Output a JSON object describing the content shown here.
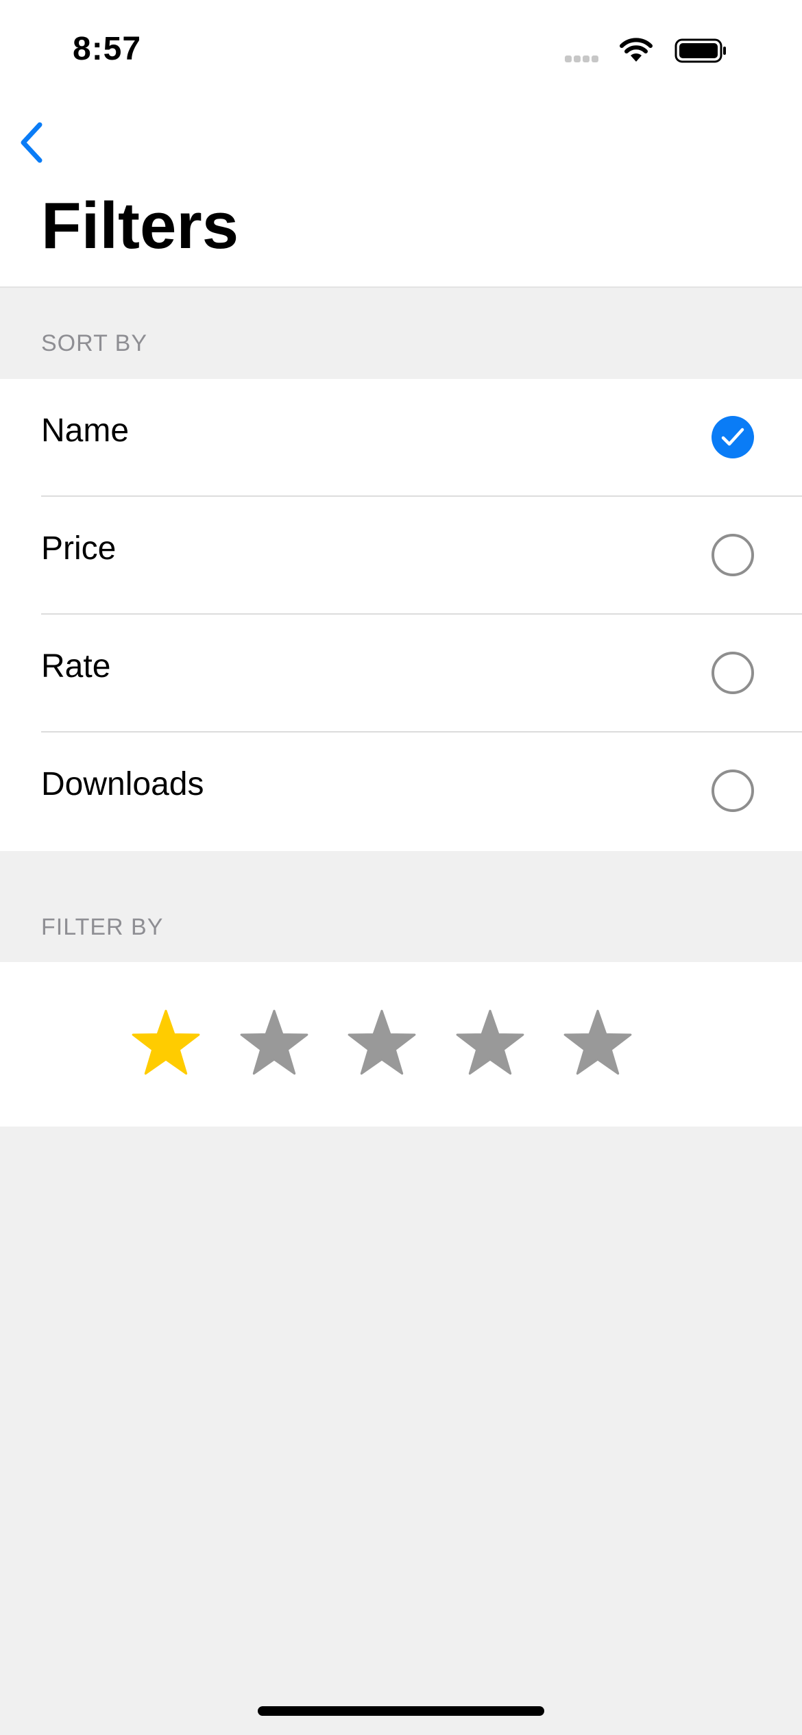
{
  "status_bar": {
    "time": "8:57"
  },
  "nav": {
    "title": "Filters"
  },
  "sort_section": {
    "header": "SORT BY",
    "options": [
      {
        "label": "Name",
        "selected": true
      },
      {
        "label": "Price",
        "selected": false
      },
      {
        "label": "Rate",
        "selected": false
      },
      {
        "label": "Downloads",
        "selected": false
      }
    ]
  },
  "filter_section": {
    "header": "FILTER BY",
    "rating": {
      "selected": 1,
      "max": 5,
      "active_color": "#ffcc00",
      "inactive_color": "#999999"
    }
  },
  "colors": {
    "accent": "#0a7cf6",
    "background": "#f0f0f0"
  }
}
